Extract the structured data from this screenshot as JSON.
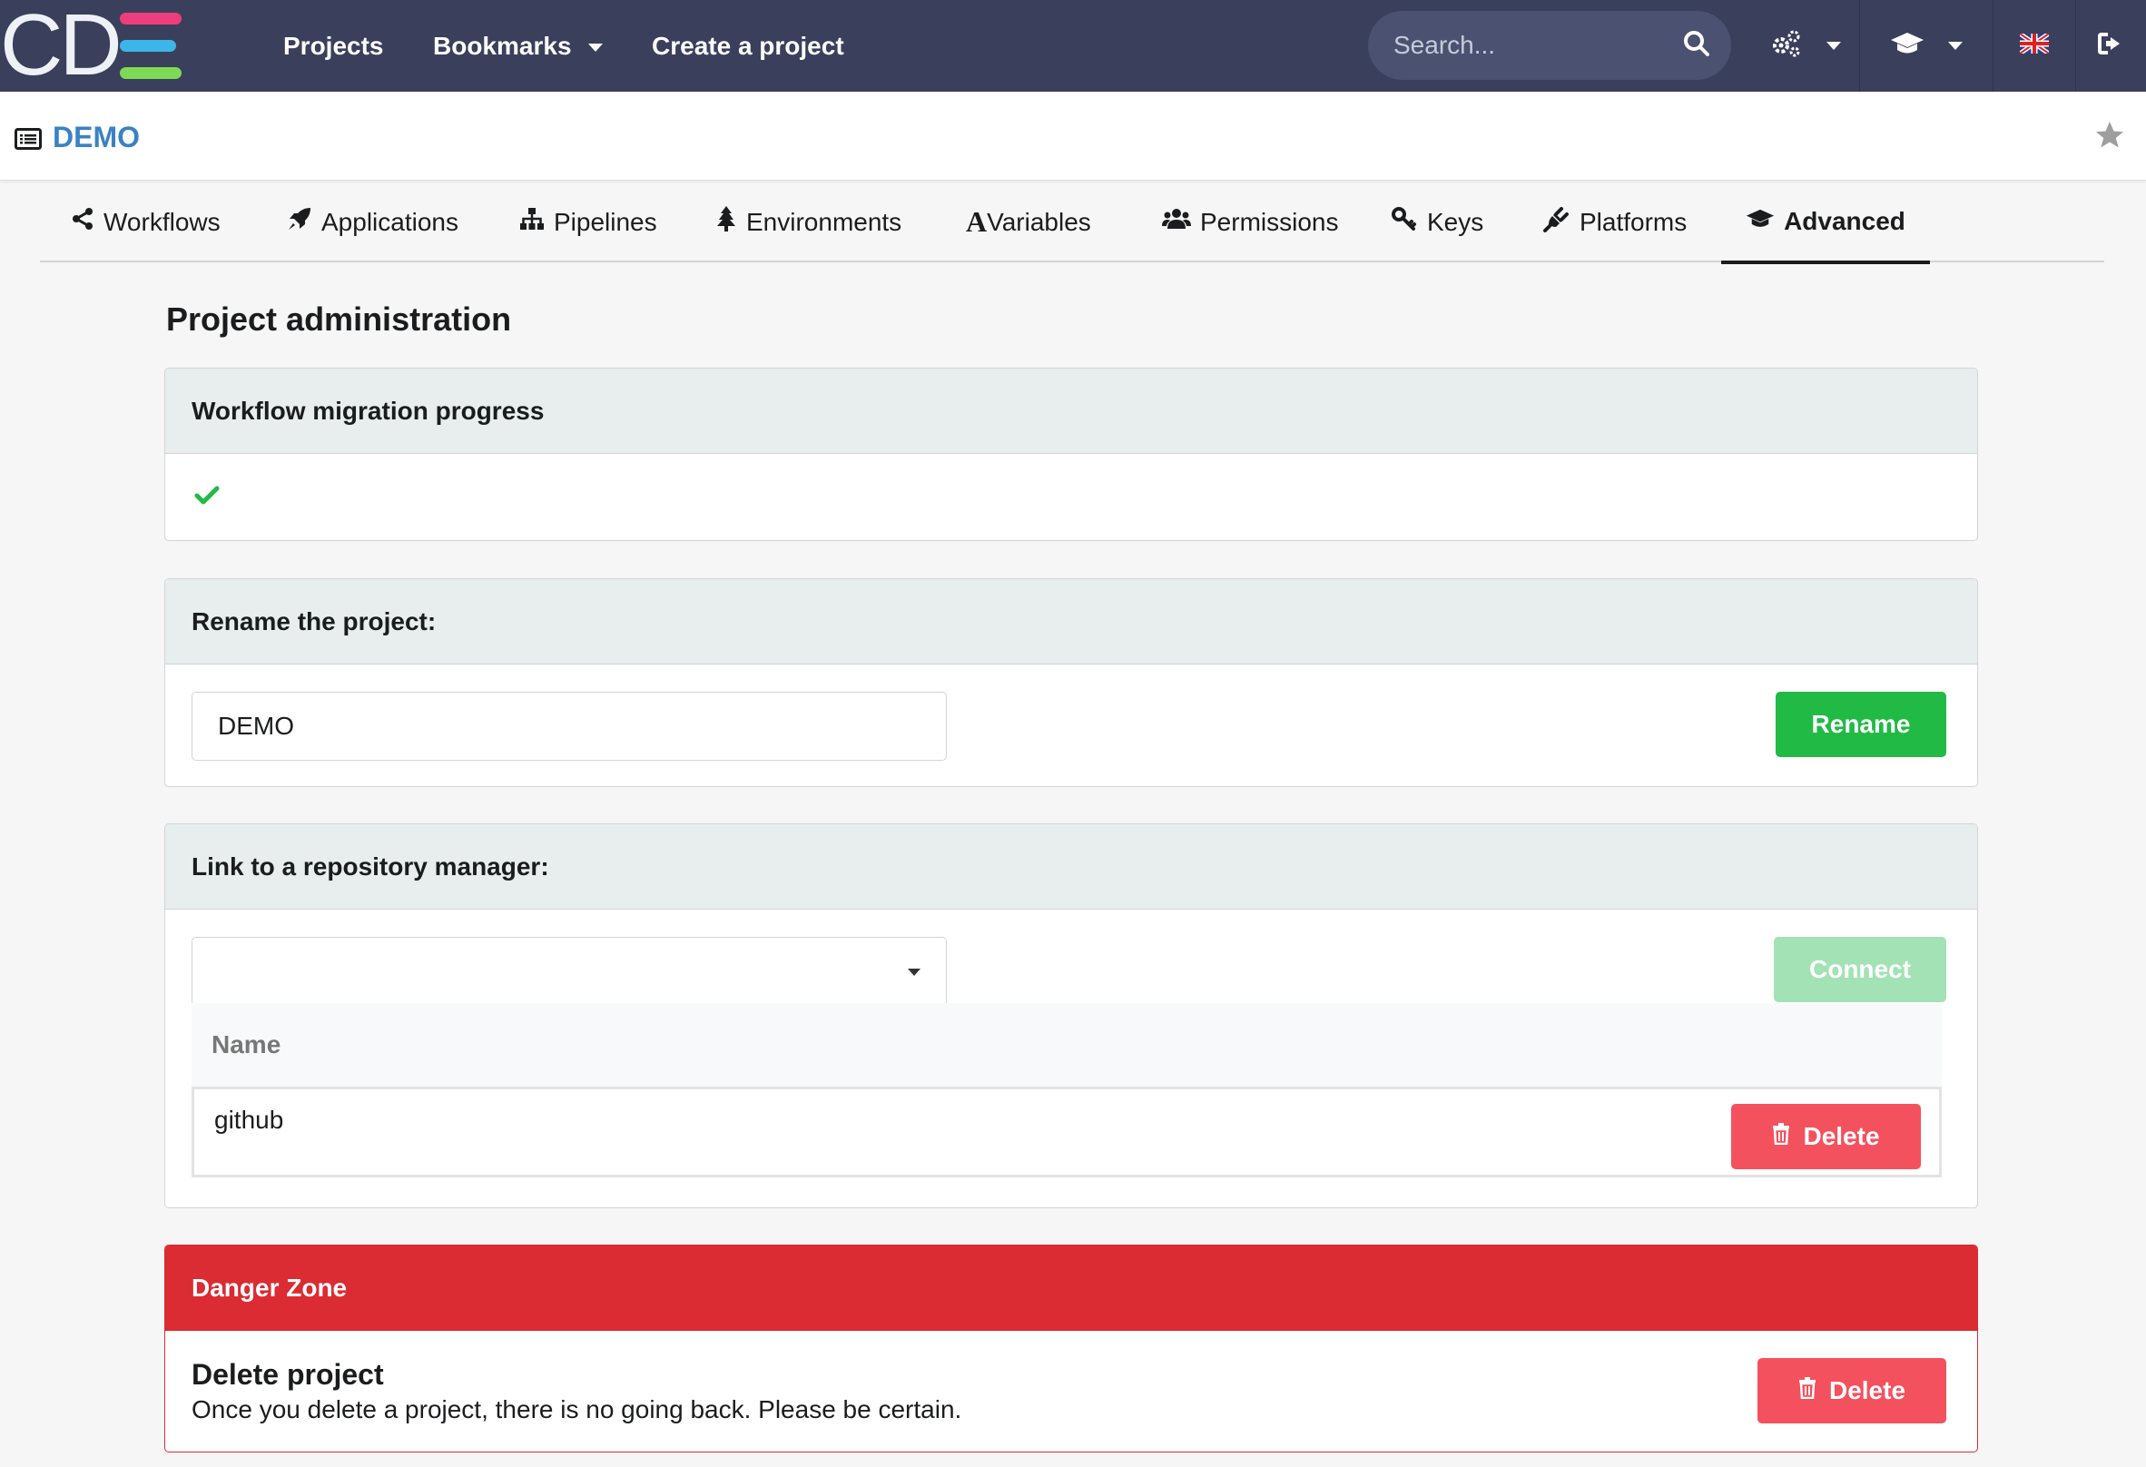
{
  "nav": {
    "logo_text": "CD",
    "projects": "Projects",
    "bookmarks": "Bookmarks",
    "create_project": "Create a project",
    "search_placeholder": "Search..."
  },
  "project": {
    "name": "DEMO"
  },
  "tabs": [
    {
      "label": "Workflows",
      "icon": "share-icon"
    },
    {
      "label": "Applications",
      "icon": "rocket-icon"
    },
    {
      "label": "Pipelines",
      "icon": "sitemap-icon"
    },
    {
      "label": "Environments",
      "icon": "tree-icon"
    },
    {
      "label": "Variables",
      "icon": "font-icon"
    },
    {
      "label": "Permissions",
      "icon": "users-icon"
    },
    {
      "label": "Keys",
      "icon": "key-icon"
    },
    {
      "label": "Platforms",
      "icon": "plug-icon"
    },
    {
      "label": "Advanced",
      "icon": "graduation-cap-icon",
      "active": true
    }
  ],
  "page_title": "Project administration",
  "migration": {
    "title": "Workflow migration progress",
    "status_icon": "check-icon"
  },
  "rename": {
    "title": "Rename the project:",
    "value": "DEMO",
    "button": "Rename"
  },
  "repo": {
    "title": "Link to a repository manager:",
    "select_value": "",
    "button": "Connect",
    "column_name": "Name",
    "rows": [
      {
        "name": "github",
        "action": "Delete"
      }
    ]
  },
  "danger": {
    "title": "Danger Zone",
    "delete_title": "Delete project",
    "delete_desc": "Once you delete a project, there is no going back. Please be certain.",
    "button": "Delete"
  },
  "colors": {
    "navbar": "#3a3f5c",
    "accent_blue": "#3b82c4",
    "green": "#21ba45",
    "red": "#f4515e",
    "danger_header": "#db2b33"
  }
}
